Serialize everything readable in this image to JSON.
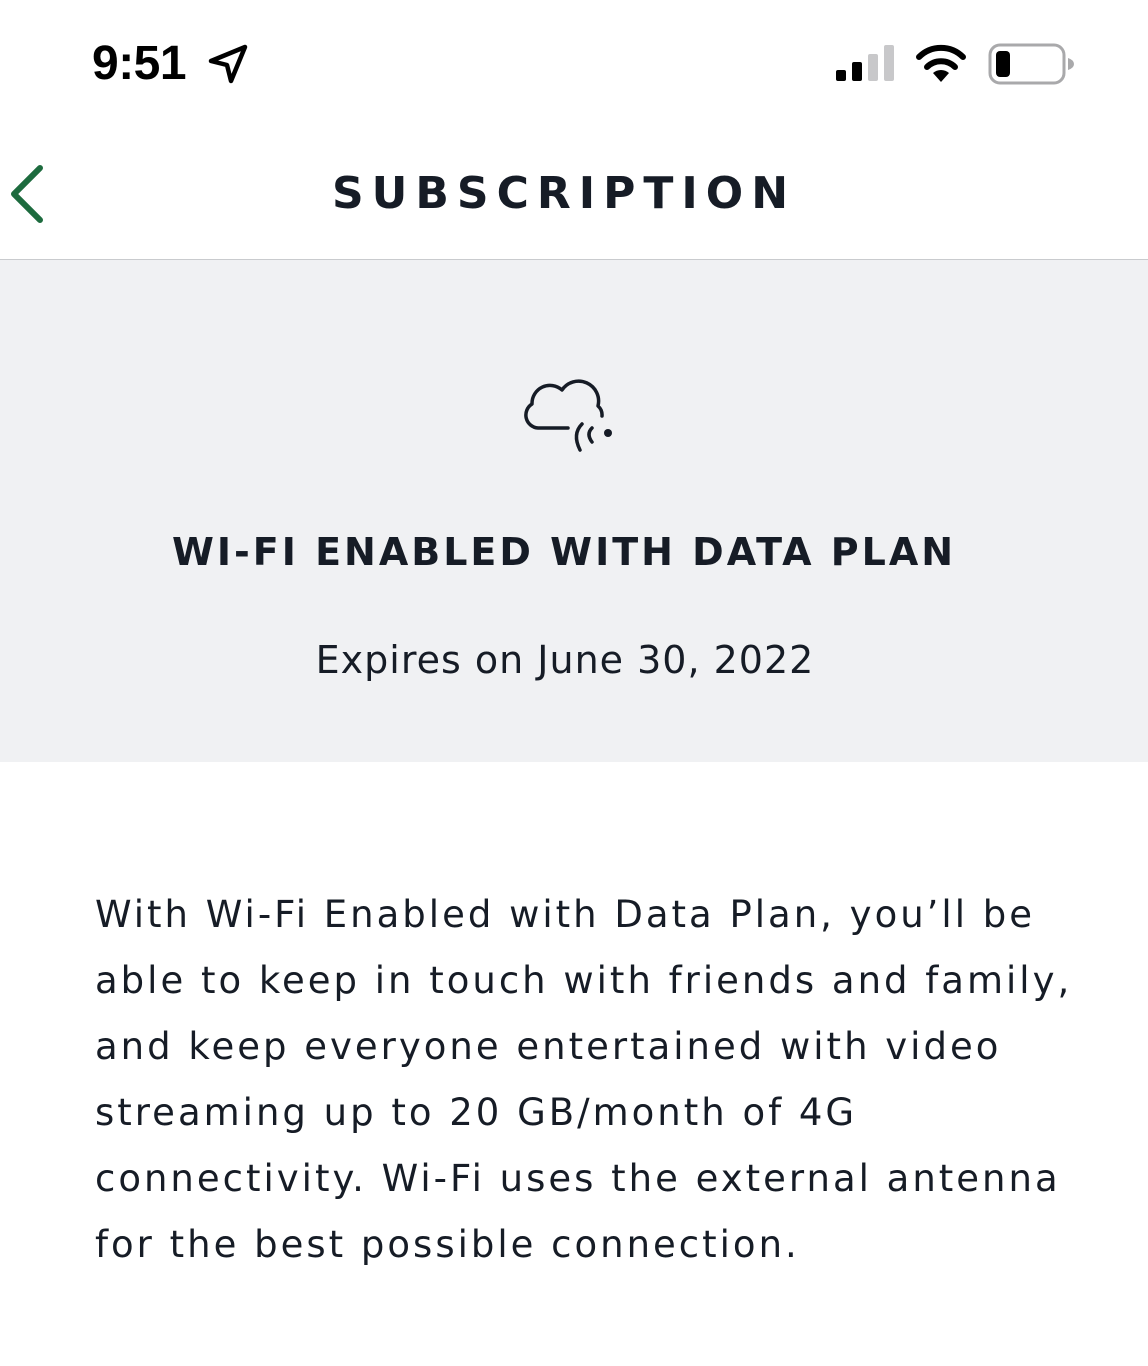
{
  "status_bar": {
    "time": "9:51",
    "location_icon": "location-arrow-icon",
    "signal_icon": "cellular-signal-icon",
    "wifi_icon": "wifi-icon",
    "battery_icon": "battery-icon",
    "battery_level": 0.15,
    "signal_bars_active": 2,
    "signal_bars_total": 4
  },
  "nav": {
    "back_icon": "chevron-left-icon",
    "title": "SUBSCRIPTION",
    "accent_color": "#1d6b3e"
  },
  "plan": {
    "icon": "cloud-wireless-icon",
    "name": "WI-FI ENABLED WITH DATA PLAN",
    "expiry": "Expires on June 30, 2022",
    "background_color": "#f0f1f3"
  },
  "description": "With Wi-Fi Enabled with Data Plan, you’ll be able to keep in touch with friends and family, and keep everyone entertained with video streaming up to 20 GB/month of 4G connectivity. Wi-Fi uses the external antenna for the best possible connection."
}
